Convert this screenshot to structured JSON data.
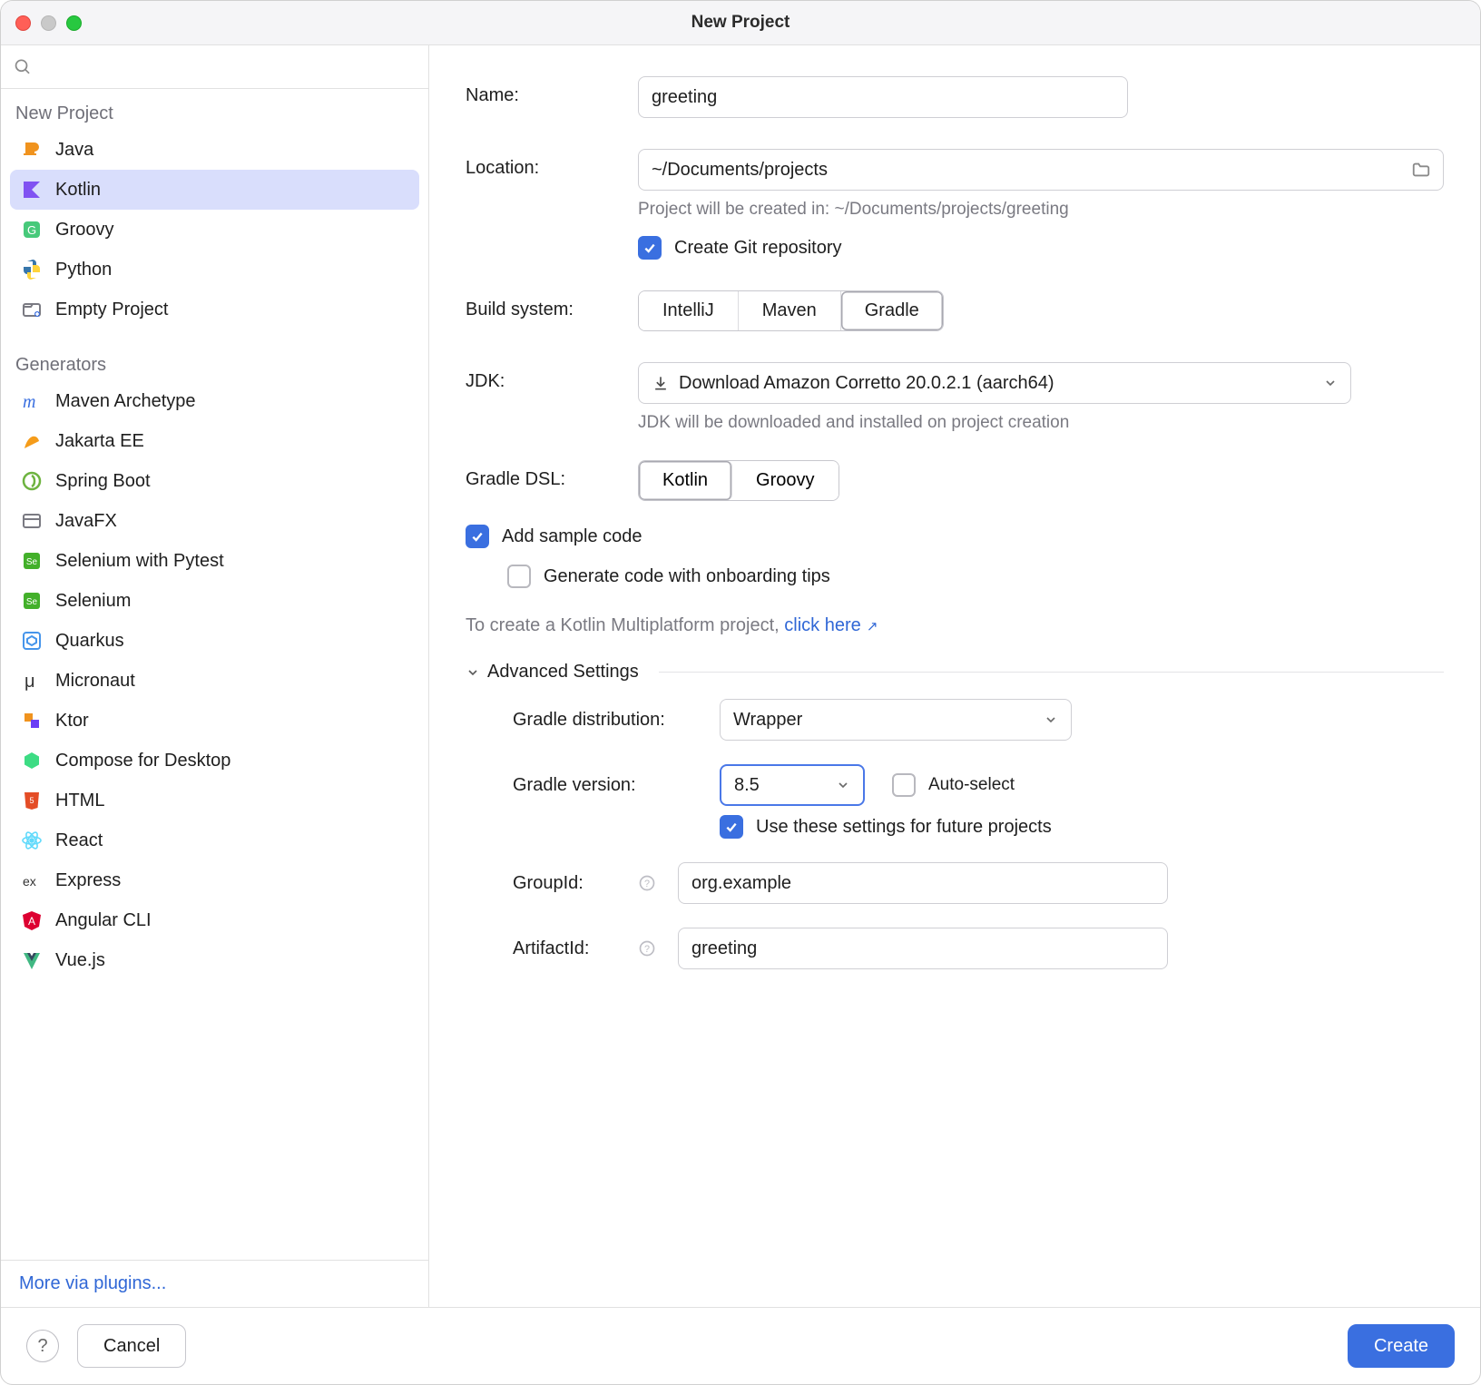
{
  "window": {
    "title": "New Project"
  },
  "sidebar": {
    "new_project_heading": "New Project",
    "generators_heading": "Generators",
    "projects": [
      {
        "label": "Java"
      },
      {
        "label": "Kotlin",
        "selected": true
      },
      {
        "label": "Groovy"
      },
      {
        "label": "Python"
      },
      {
        "label": "Empty Project"
      }
    ],
    "generators": [
      {
        "label": "Maven Archetype"
      },
      {
        "label": "Jakarta EE"
      },
      {
        "label": "Spring Boot"
      },
      {
        "label": "JavaFX"
      },
      {
        "label": "Selenium with Pytest"
      },
      {
        "label": "Selenium"
      },
      {
        "label": "Quarkus"
      },
      {
        "label": "Micronaut"
      },
      {
        "label": "Ktor"
      },
      {
        "label": "Compose for Desktop"
      },
      {
        "label": "HTML"
      },
      {
        "label": "React"
      },
      {
        "label": "Express"
      },
      {
        "label": "Angular CLI"
      },
      {
        "label": "Vue.js"
      }
    ],
    "more_link": "More via plugins..."
  },
  "form": {
    "labels": {
      "name": "Name:",
      "location": "Location:",
      "build_system": "Build system:",
      "jdk": "JDK:",
      "gradle_dsl": "Gradle DSL:"
    },
    "name_value": "greeting",
    "location_value": "~/Documents/projects",
    "location_hint": "Project will be created in: ~/Documents/projects/greeting",
    "create_git_label": "Create Git repository",
    "create_git_checked": true,
    "build_system": {
      "options": [
        "IntelliJ",
        "Maven",
        "Gradle"
      ],
      "selected": "Gradle"
    },
    "jdk": {
      "value": "Download Amazon Corretto 20.0.2.1 (aarch64)",
      "hint": "JDK will be downloaded and installed on project creation"
    },
    "gradle_dsl": {
      "options": [
        "Kotlin",
        "Groovy"
      ],
      "selected": "Kotlin"
    },
    "add_sample_label": "Add sample code",
    "add_sample_checked": true,
    "onboarding_label": "Generate code with onboarding tips",
    "onboarding_checked": false,
    "multiplatform_prefix": "To create a Kotlin Multiplatform project, ",
    "multiplatform_link": "click here"
  },
  "advanced": {
    "title": "Advanced Settings",
    "labels": {
      "distro": "Gradle distribution:",
      "version": "Gradle version:",
      "group": "GroupId:",
      "artifact": "ArtifactId:"
    },
    "distro_value": "Wrapper",
    "version_value": "8.5",
    "auto_select_label": "Auto-select",
    "auto_select_checked": false,
    "future_label": "Use these settings for future projects",
    "future_checked": true,
    "group_value": "org.example",
    "artifact_value": "greeting"
  },
  "footer": {
    "cancel": "Cancel",
    "create": "Create"
  }
}
